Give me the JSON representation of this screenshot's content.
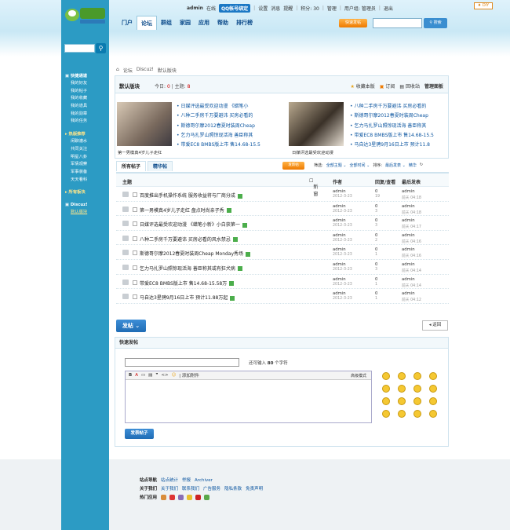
{
  "topbar": {
    "user": "admin",
    "online": "在线",
    "qq": "QQ帐号绑定",
    "links": [
      "设置",
      "消息",
      "提醒"
    ],
    "credits": "积分: 30",
    "manage": "管理",
    "usergroup": "用户组: 管理员",
    "logout": "退出",
    "diy": "DIY"
  },
  "logo": {
    "text": "酷站"
  },
  "nav": [
    "门户",
    "论坛",
    "群组",
    "家园",
    "应用",
    "帮助",
    "排行榜"
  ],
  "header": {
    "post_button": "快速发帖",
    "search_button": "搜索"
  },
  "sidebar": {
    "sections": [
      {
        "title": "快捷通道",
        "items": [
          "我的好友",
          "我的帖子",
          "我的收藏",
          "我的道具",
          "我的勋章",
          "我的任务"
        ]
      },
      {
        "title": "热版推荐",
        "items": [
          "闲聊灌水",
          "共同关注",
          "明星八卦",
          "军情观察",
          "军事装备",
          "天天看科"
        ]
      },
      {
        "title": "所有板块",
        "items": []
      },
      {
        "title": "Discuz!",
        "items": [
          "默认版块"
        ]
      }
    ]
  },
  "breadcrumb": [
    "论坛",
    "Discuz!",
    "默认版块"
  ],
  "forum": {
    "title": "默认版块",
    "today_label": "今日:",
    "today": "0",
    "topics_label": "主题:",
    "topics": "8",
    "tools": [
      "收藏本版",
      "订阅",
      "回收站",
      "管理面板"
    ]
  },
  "features": [
    {
      "caption": "第一男模真4岁儿子走红"
    },
    {
      "caption": "日媒评选最受欢迎动漫"
    }
  ],
  "headlines_left": [
    "日媒评选最受欢迎动漫 《蜡笔小",
    "八种二手房千万要避讳 买房必看的",
    "斯德哥尔摩2012春夏时装周Cheap",
    "乞力马扎罗山照惊现活海 善臣称其",
    "带爱EC8 BMBS版上市 售14.68-15.5"
  ],
  "headlines_right": [
    "八种二手房千万要避讳 买房必看的",
    "斯德哥尔摩2012春夏时装周Cheap",
    "乞力马扎罗山照惊现活海 善臣称其",
    "带爱EC8 BMBS版上市 售14.68-15.5",
    "马自达3星骋9月16日上市 预计11.8"
  ],
  "tabs": [
    "所有帖子",
    "精华帖"
  ],
  "list_toolbar": {
    "new_post": "发新帖",
    "filter": "筛选:",
    "all_topics": "全部主题",
    "all_time": "全部时间",
    "sort": "排序:",
    "latest": "最后发表",
    "digest": "精华"
  },
  "table": {
    "headers": {
      "subject": "主题",
      "new": "新窗",
      "author": "作者",
      "replies": "回复/查看",
      "last": "最后发表"
    },
    "rows": [
      {
        "title": "百度推出手机操作系统 服务收益将与厂商分成",
        "author": "admin",
        "date": "2012-3-23",
        "replies": "0",
        "views": "19",
        "last_user": "admin",
        "last_time": "前天 04:18"
      },
      {
        "title": "第一男模真4岁儿子走红 盘点时尚亲子秀",
        "author": "admin",
        "date": "2012-3-23",
        "replies": "0",
        "views": "3",
        "last_user": "admin",
        "last_time": "前天 04:18"
      },
      {
        "title": "日媒评选最受欢迎动漫 《蜡笔小新》小白获第一",
        "author": "admin",
        "date": "2012-3-23",
        "replies": "0",
        "views": "3",
        "last_user": "admin",
        "last_time": "前天 04:17"
      },
      {
        "title": "八种二手房千万要避讳 买房必看的风水禁忌",
        "author": "admin",
        "date": "2012-3-23",
        "replies": "0",
        "views": "2",
        "last_user": "admin",
        "last_time": "前天 04:16"
      },
      {
        "title": "斯德哥尔摩2012春夏时装周Cheap Monday秀场",
        "author": "admin",
        "date": "2012-3-23",
        "replies": "0",
        "views": "1",
        "last_user": "admin",
        "last_time": "前天 04:16"
      },
      {
        "title": "乞力马扎罗山照惊现活海 善臣称其或有狂犬病",
        "author": "admin",
        "date": "2012-3-23",
        "replies": "0",
        "views": "3",
        "last_user": "admin",
        "last_time": "前天 04:14"
      },
      {
        "title": "带爱EC8 BMBS版上市 售14.68-15.58万",
        "author": "admin",
        "date": "2012-3-23",
        "replies": "0",
        "views": "1",
        "last_user": "admin",
        "last_time": "前天 04:14"
      },
      {
        "title": "马自达3星骋9月16日上市 预计11.88万起",
        "author": "admin",
        "date": "2012-3-23",
        "replies": "0",
        "views": "1",
        "last_user": "admin",
        "last_time": "前天 04:12"
      }
    ]
  },
  "actions": {
    "post": "发帖",
    "back": "返回"
  },
  "quickpost": {
    "title": "快速发帖",
    "hint_pre": "还可输入",
    "hint_num": "80",
    "hint_post": "个字符",
    "attach": "添加附件",
    "advanced": "高级模式",
    "submit": "发表帖子"
  },
  "footer": {
    "nav_label": "站点导航",
    "nav": [
      "站点统计",
      "举报",
      "Archiver"
    ],
    "about_label": "关于我们",
    "about": [
      "关于我们",
      "联系我们",
      "广告服务",
      "隐私条款",
      "免责声明"
    ],
    "apps_label": "热门应用"
  },
  "colors": {
    "sidebar": "#2c9bc4",
    "accent": "#ee7a00",
    "link": "#0b55a0"
  }
}
